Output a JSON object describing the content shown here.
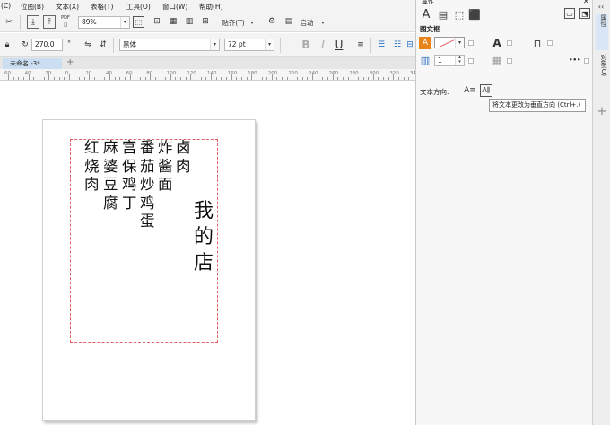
{
  "menu": {
    "items": [
      "(C)",
      "位图(B)",
      "文本(X)",
      "表格(T)",
      "工具(O)",
      "窗口(W)",
      "帮助(H)"
    ]
  },
  "toolbar1": {
    "zoom_value": "89%",
    "paste_label": "贴齐(T)",
    "launch_label": "启动",
    "pdf_label": "PDF"
  },
  "toolbar2": {
    "angle_value": "270.0",
    "font_name": "黑体",
    "font_size": "72 pt",
    "bold": "B",
    "italic": "I",
    "underline": "U"
  },
  "document": {
    "tab_label": "未命名 -3*",
    "add_tab": "+"
  },
  "ruler": {
    "labels": [
      "60",
      "40",
      "20",
      "0",
      "20",
      "40",
      "60",
      "80",
      "100",
      "120",
      "140",
      "160",
      "180",
      "200",
      "220",
      "240",
      "260",
      "280",
      "300",
      "320",
      "340"
    ]
  },
  "canvas_text": {
    "columns": [
      [
        "红",
        "烧",
        "肉"
      ],
      [
        "麻",
        "婆",
        "豆",
        "腐"
      ],
      [
        "宫",
        "保",
        "鸡",
        "丁"
      ],
      [
        "番",
        "茄",
        "炒",
        "鸡",
        "蛋"
      ],
      [
        "炸",
        "酱",
        "面"
      ],
      [
        "卤",
        "肉"
      ]
    ],
    "title_column": [
      "我",
      "的",
      "店"
    ]
  },
  "panel": {
    "title": "属性",
    "section_frame": "图文框",
    "columns_value": "1",
    "text_direction_label": "文本方向:",
    "tooltip": "将文本更改为垂直方向 (Ctrl+.)",
    "more": "•••"
  },
  "dock": {
    "tab_properties": "属性",
    "tab_objects": "对象(O)",
    "add": "+"
  },
  "colors": {
    "frame_border": "#e06060",
    "tab_active": "#ccdff2",
    "accent_orange": "#e8841a"
  }
}
